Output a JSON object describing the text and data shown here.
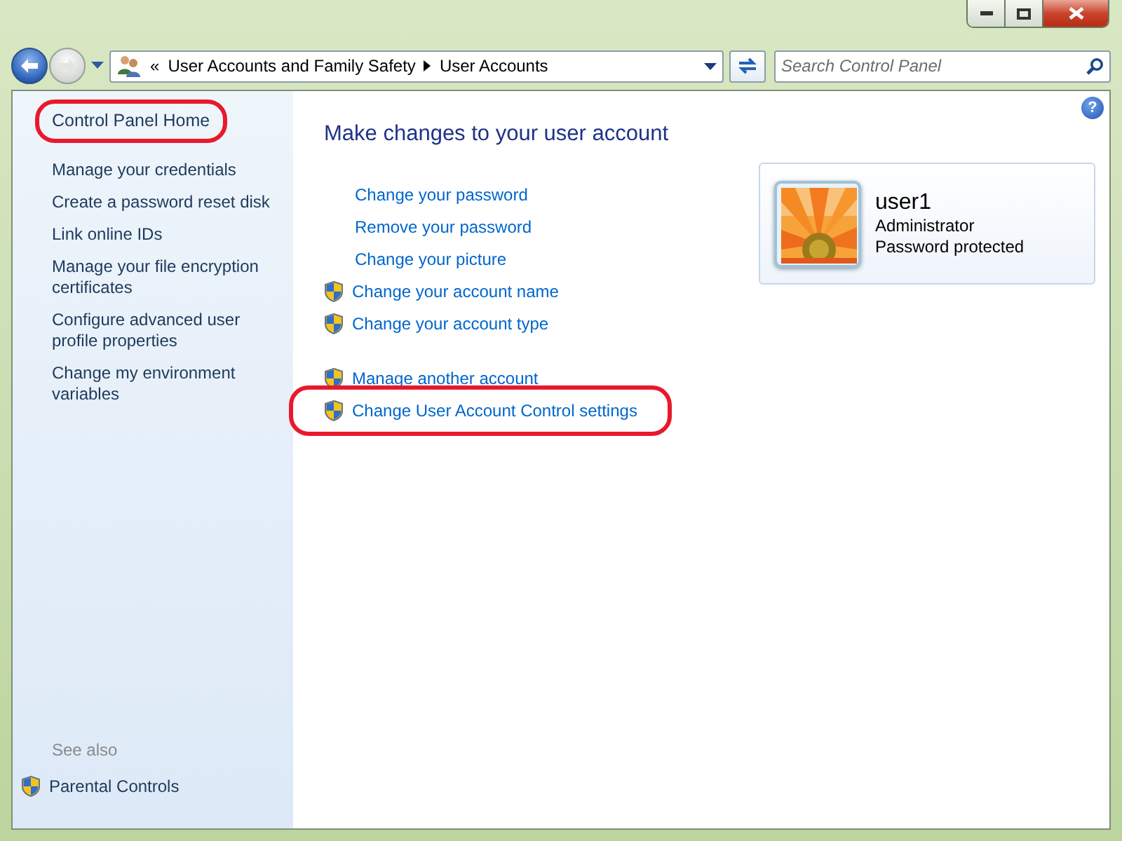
{
  "address_bar": {
    "overflow": "«",
    "crumbs": [
      "User Accounts and Family Safety",
      "User Accounts"
    ]
  },
  "search": {
    "placeholder": "Search Control Panel"
  },
  "help": {
    "glyph": "?"
  },
  "sidebar": {
    "items": [
      {
        "label": "Control Panel Home",
        "kind": "heading",
        "circled": true
      },
      {
        "label": "Manage your credentials",
        "kind": "link",
        "circled": false
      },
      {
        "label": "Create a password reset disk",
        "kind": "link",
        "circled": false
      },
      {
        "label": "Link online IDs",
        "kind": "link",
        "circled": false
      },
      {
        "label": "Manage your file encryption certificates",
        "kind": "link",
        "circled": false
      },
      {
        "label": "Configure advanced user profile properties",
        "kind": "link",
        "circled": false
      },
      {
        "label": "Change my environment variables",
        "kind": "link",
        "circled": false
      }
    ],
    "see_also": {
      "title": "See also",
      "items": [
        {
          "label": "Parental Controls",
          "kind": "shield_link"
        }
      ]
    }
  },
  "main": {
    "title": "Make changes to your user account",
    "groups": [
      [
        {
          "label": "Change your password",
          "kind": "link",
          "circled": false
        },
        {
          "label": "Remove your password",
          "kind": "link",
          "circled": false
        },
        {
          "label": "Change your picture",
          "kind": "link",
          "circled": false
        },
        {
          "label": "Change your account name",
          "kind": "shield_link",
          "circled": false
        },
        {
          "label": "Change your account type",
          "kind": "shield_link",
          "circled": false
        }
      ],
      [
        {
          "label": "Manage another account",
          "kind": "shield_link",
          "circled": false
        },
        {
          "label": "Change User Account Control settings",
          "kind": "shield_link",
          "circled": true
        }
      ]
    ],
    "account": {
      "name": "user1",
      "type": "Administrator",
      "status": "Password protected"
    }
  }
}
